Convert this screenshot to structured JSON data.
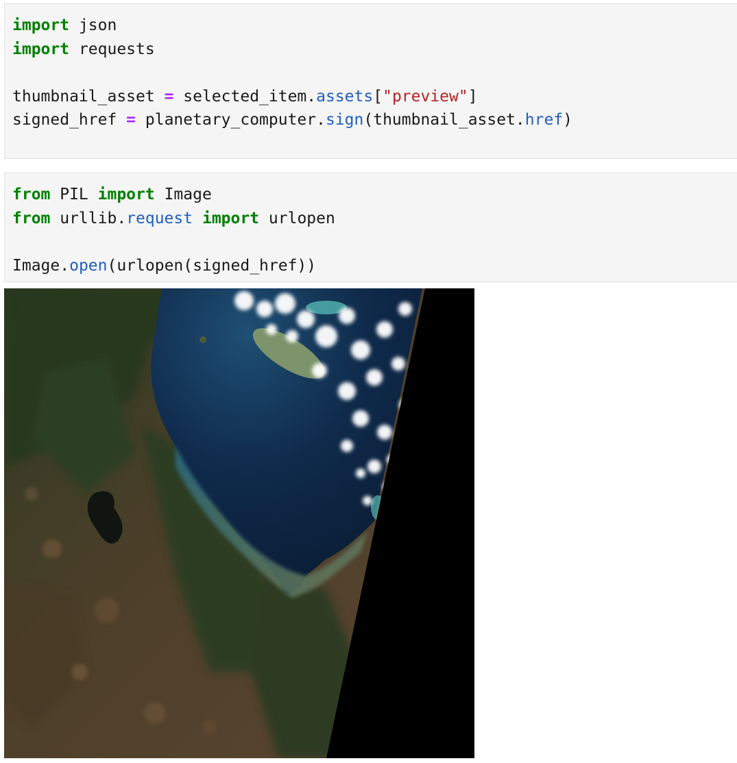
{
  "cells": [
    {
      "lines": [
        [
          {
            "k": "kw",
            "t": "import"
          },
          {
            "k": "",
            "t": " json"
          }
        ],
        [
          {
            "k": "kw",
            "t": "import"
          },
          {
            "k": "",
            "t": " requests"
          }
        ],
        [],
        [
          {
            "k": "",
            "t": "thumbnail_asset "
          },
          {
            "k": "op",
            "t": "="
          },
          {
            "k": "",
            "t": " selected_item."
          },
          {
            "k": "attr",
            "t": "assets"
          },
          {
            "k": "",
            "t": "["
          },
          {
            "k": "str",
            "t": "\"preview\""
          },
          {
            "k": "",
            "t": "]"
          }
        ],
        [
          {
            "k": "",
            "t": "signed_href "
          },
          {
            "k": "op",
            "t": "="
          },
          {
            "k": "",
            "t": " planetary_computer."
          },
          {
            "k": "attr",
            "t": "sign"
          },
          {
            "k": "",
            "t": "(thumbnail_asset."
          },
          {
            "k": "attr",
            "t": "href"
          },
          {
            "k": "",
            "t": ")"
          }
        ]
      ]
    },
    {
      "lines": [
        [
          {
            "k": "kw",
            "t": "from"
          },
          {
            "k": "",
            "t": " PIL "
          },
          {
            "k": "kw",
            "t": "import"
          },
          {
            "k": "",
            "t": " Image"
          }
        ],
        [
          {
            "k": "kw",
            "t": "from"
          },
          {
            "k": "",
            "t": " urllib."
          },
          {
            "k": "attr",
            "t": "request"
          },
          {
            "k": "",
            "t": " "
          },
          {
            "k": "kw",
            "t": "import"
          },
          {
            "k": "",
            "t": " urlopen"
          }
        ],
        [],
        [
          {
            "k": "",
            "t": "Image."
          },
          {
            "k": "attr",
            "t": "open"
          },
          {
            "k": "",
            "t": "(urlopen(signed_href))"
          }
        ]
      ]
    }
  ],
  "output": {
    "type": "image",
    "alt": "satellite-preview-image",
    "colors": {
      "land_dark": "#3a3f24",
      "land_brown": "#5a4631",
      "forest": "#26391d",
      "sea_deep": "#0f2442",
      "sea_shallow": "#2f5e6a",
      "cloud": "#ffffff",
      "nodata": "#000000"
    }
  }
}
